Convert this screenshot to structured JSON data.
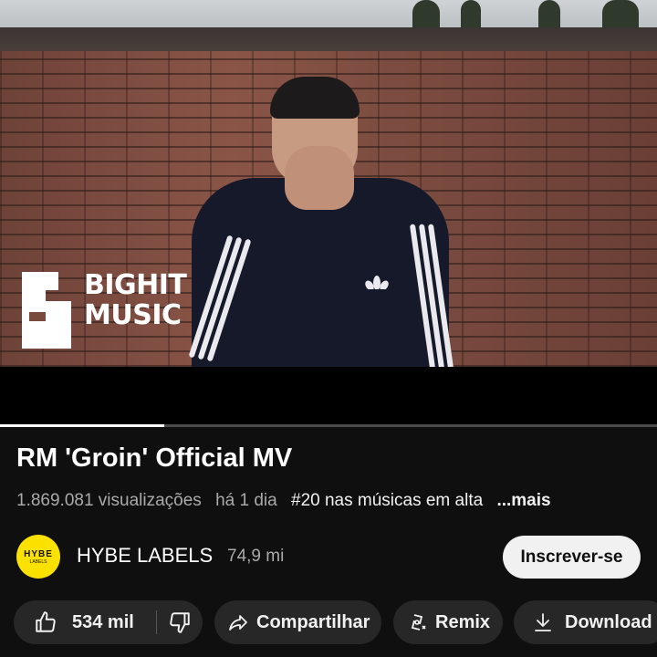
{
  "video": {
    "overlay_logo_line1": "BIGHIT",
    "overlay_logo_line2": "MUSIC",
    "progress_fraction": 0.25
  },
  "title": "RM 'Groin' Official MV",
  "meta": {
    "views": "1.869.081 visualizações",
    "age": "há 1 dia",
    "trending": "#20 nas músicas em alta",
    "more": "...mais"
  },
  "channel": {
    "avatar_line1": "HYBE",
    "avatar_line2": "LABELS",
    "name": "HYBE LABELS",
    "subscribers": "74,9 mi",
    "subscribe_label": "Inscrever-se",
    "avatar_color": "#fbe100"
  },
  "actions": {
    "likes": "534 mil",
    "share_label": "Compartilhar",
    "remix_label": "Remix",
    "download_label": "Download",
    "icons": [
      "thumbs-up-icon",
      "thumbs-down-icon",
      "share-icon",
      "remix-icon",
      "download-icon"
    ]
  },
  "colors": {
    "background": "#0f0f0f",
    "chip": "#272727",
    "subscribe_bg": "#f1f1f1",
    "secondary_text": "#aaaaaa"
  }
}
